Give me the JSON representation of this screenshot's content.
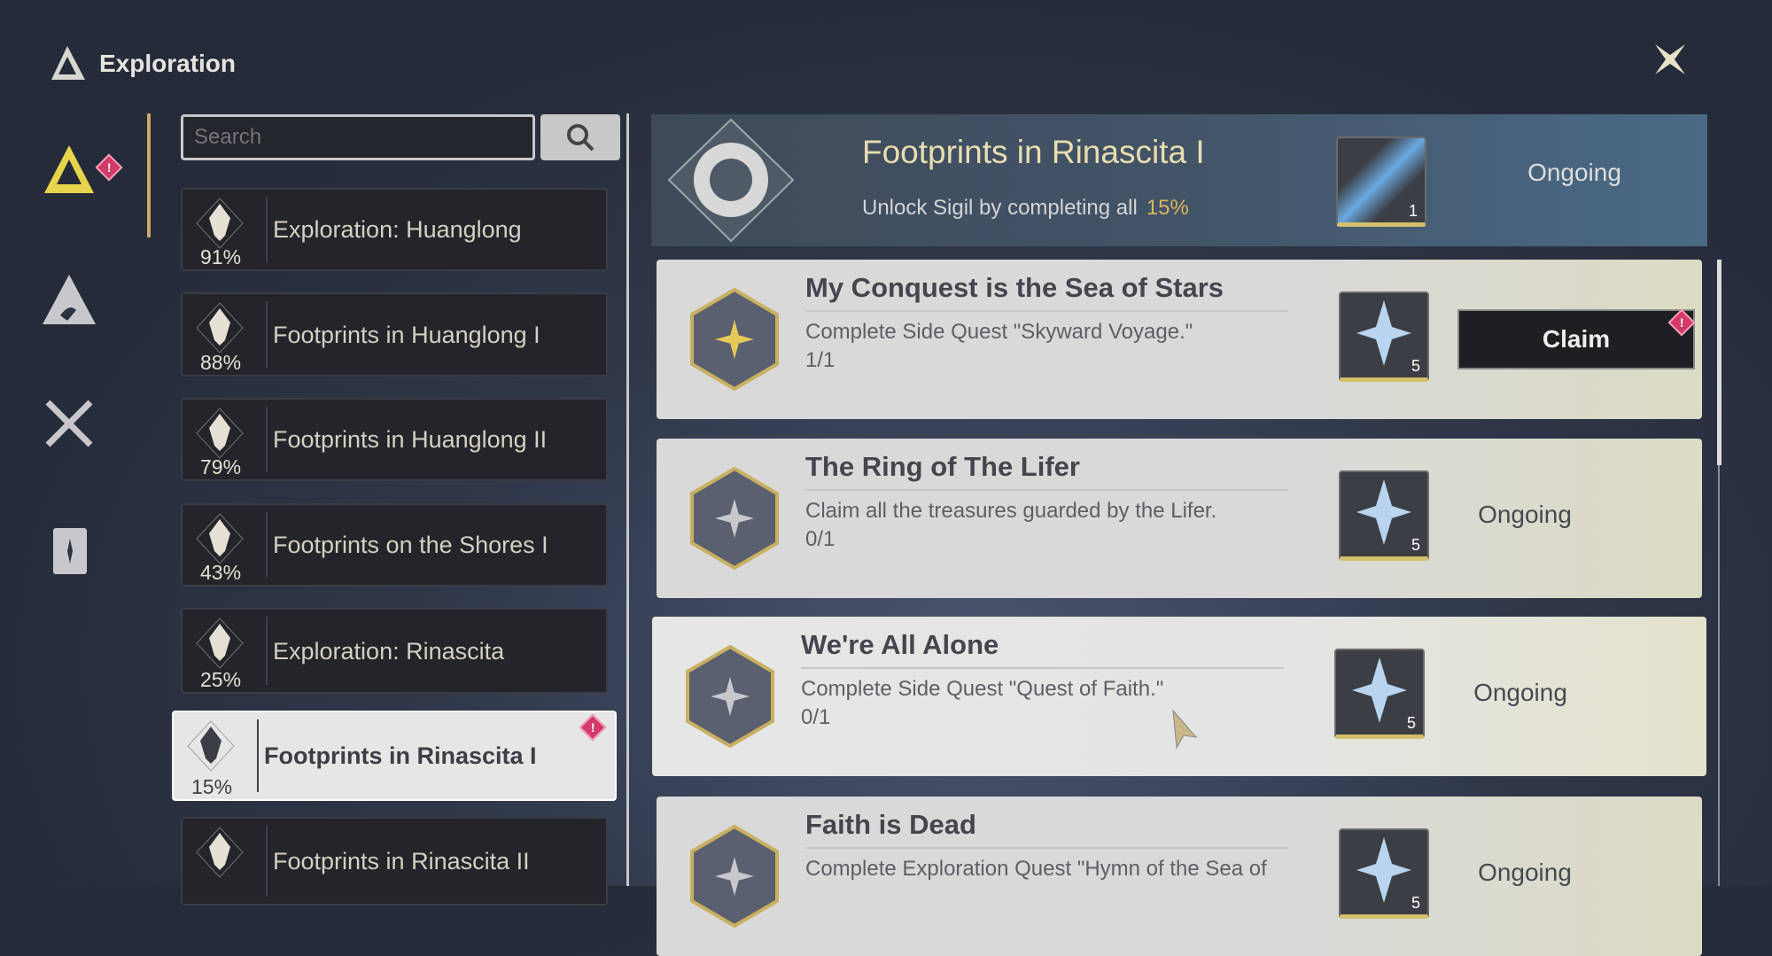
{
  "header": {
    "title": "Exploration",
    "logo_icon": "exploration-logo-icon",
    "close_icon": "close-icon"
  },
  "nav": [
    {
      "icon": "exploration-icon",
      "active": true,
      "badge": "!"
    },
    {
      "icon": "mountain-icon"
    },
    {
      "icon": "crossed-swords-icon"
    },
    {
      "icon": "book-icon"
    }
  ],
  "search": {
    "placeholder": "Search",
    "button_icon": "search-icon"
  },
  "list": [
    {
      "name": "Exploration: Huanglong",
      "pct": "91%"
    },
    {
      "name": "Footprints in Huanglong I",
      "pct": "88%"
    },
    {
      "name": "Footprints in Huanglong II",
      "pct": "79%"
    },
    {
      "name": "Footprints on the Shores I",
      "pct": "43%"
    },
    {
      "name": "Exploration: Rinascita",
      "pct": "25%"
    },
    {
      "name": "Footprints in Rinascita I",
      "pct": "15%",
      "selected": true,
      "badge": "!"
    },
    {
      "name": "Footprints in Rinascita II",
      "pct": ""
    }
  ],
  "detail": {
    "title": "Footprints in Rinascita I",
    "subtitle": "Unlock Sigil by completing all",
    "progress": "15%",
    "reward_count": "1",
    "status": "Ongoing"
  },
  "quests": [
    {
      "title": "My Conquest is the Sea of Stars",
      "desc": "Complete Side Quest \"Skyward Voyage.\"",
      "progress": "1/1",
      "reward_count": "5",
      "action": "Claim",
      "badge": "!"
    },
    {
      "title": "The Ring of The Lifer",
      "desc": "Claim all the treasures guarded by the Lifer.",
      "progress": "0/1",
      "reward_count": "5",
      "status": "Ongoing"
    },
    {
      "title": "We're All Alone",
      "desc": "Complete Side Quest \"Quest of Faith.\"",
      "progress": "0/1",
      "reward_count": "5",
      "status": "Ongoing"
    },
    {
      "title": "Faith is Dead",
      "desc": "Complete Exploration Quest \"Hymn of the Sea of",
      "progress": "",
      "reward_count": "5",
      "status": "Ongoing"
    }
  ],
  "colors": {
    "accent_gold": "#d8b85e",
    "badge_red": "#d23a68",
    "active_icon": "#e8d44a"
  }
}
